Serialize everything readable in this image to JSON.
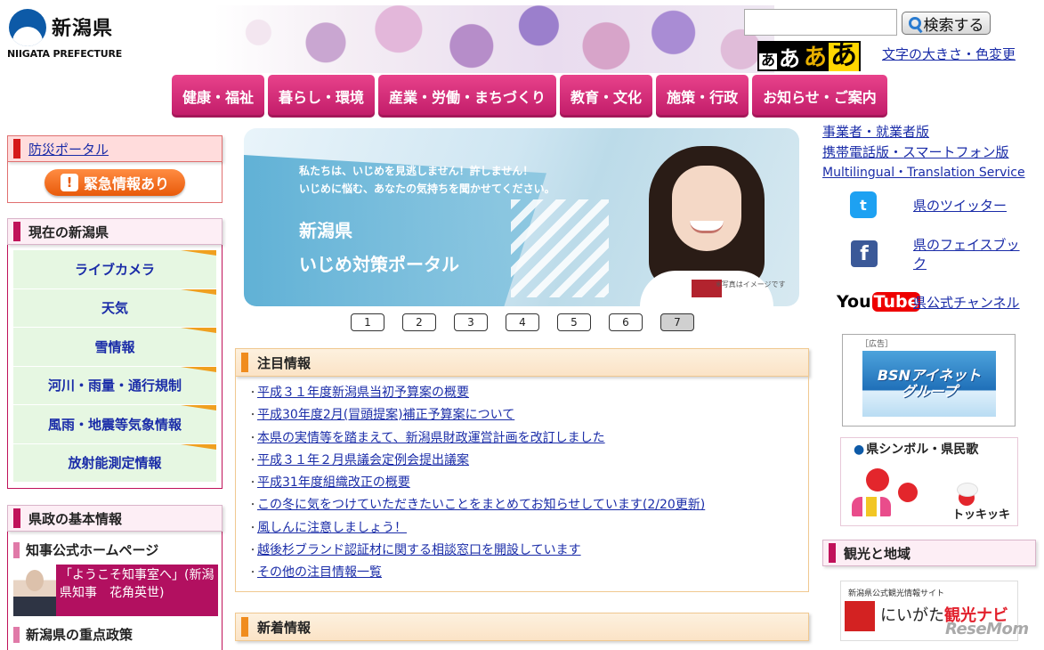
{
  "header": {
    "logo_jp": "新潟県",
    "logo_en": "NIIGATA PREFECTURE",
    "search_button": "検索する",
    "font_size_buttons": [
      "あ",
      "あ",
      "あ",
      "あ"
    ],
    "font_color_link": "文字の大きさ・色変更"
  },
  "nav": [
    "健康・福祉",
    "暮らし・環境",
    "産業・労働・まちづくり",
    "教育・文化",
    "施策・行政",
    "お知らせ・ご案内"
  ],
  "left": {
    "bousai_title": "防災ポータル",
    "emergency_button": "緊急情報あり",
    "current_title": "現在の新潟県",
    "current_items": [
      "ライブカメラ",
      "天気",
      "雪情報",
      "河川・雨量・通行規制",
      "風雨・地震等気象情報",
      "放射能測定情報"
    ],
    "kensei_title": "県政の基本情報",
    "governor_head": "知事公式ホームページ",
    "governor_text": "「ようこそ知事室へ」(新潟県知事　花角英世)",
    "policy_head": "新潟県の重点政策"
  },
  "hero": {
    "lead_1": "私たちは、いじめを見逃しません！許しません！",
    "lead_2": "いじめに悩む、あなたの気持ちを聞かせてください。",
    "title_1": "新潟県",
    "title_2": "いじめ対策ポータル",
    "note": "※写真はイメージです"
  },
  "pager": [
    "1",
    "2",
    "3",
    "4",
    "5",
    "6",
    "7"
  ],
  "notice": {
    "title": "注目情報",
    "items": [
      "平成３１年度新潟県当初予算案の概要",
      "平成30年度2月(冒頭提案)補正予算案について",
      "本県の実情等を踏まえて、新潟県財政運営計画を改訂しました",
      "平成３１年２月県議会定例会提出議案",
      "平成31年度組織改正の概要",
      "この冬に気をつけていただきたいことをまとめてお知らせしています(2/20更新)",
      "風しんに注意しましょう！",
      "越後杉ブランド認証材に関する相談窓口を開設しています",
      "その他の注目情報一覧"
    ]
  },
  "news": {
    "title": "新着情報"
  },
  "right": {
    "links": [
      "事業者・就業者版",
      "携帯電話版・スマートフォン版",
      "Multilingual・Translation Service"
    ],
    "twitter_icon_text": "t",
    "twitter_link": "県のツイッター",
    "facebook_icon_text": "f",
    "facebook_link": "県のフェイスブック",
    "youtube_you": "You",
    "youtube_tube": "Tube",
    "youtube_link": "県公式チャンネル",
    "ad_label": "［広告］",
    "ad_banner_1": "BSNアイネット",
    "ad_banner_2": "グループ",
    "symbol_title": "県シンボル・県民歌",
    "symbol_sub": "トッキッキ",
    "tourism_title": "観光と地域",
    "tourism_caption": "新潟県公式観光情報サイト",
    "tourism_name_1": "にいがた",
    "tourism_name_2": "観光ナビ"
  },
  "watermark": "ReseMom"
}
